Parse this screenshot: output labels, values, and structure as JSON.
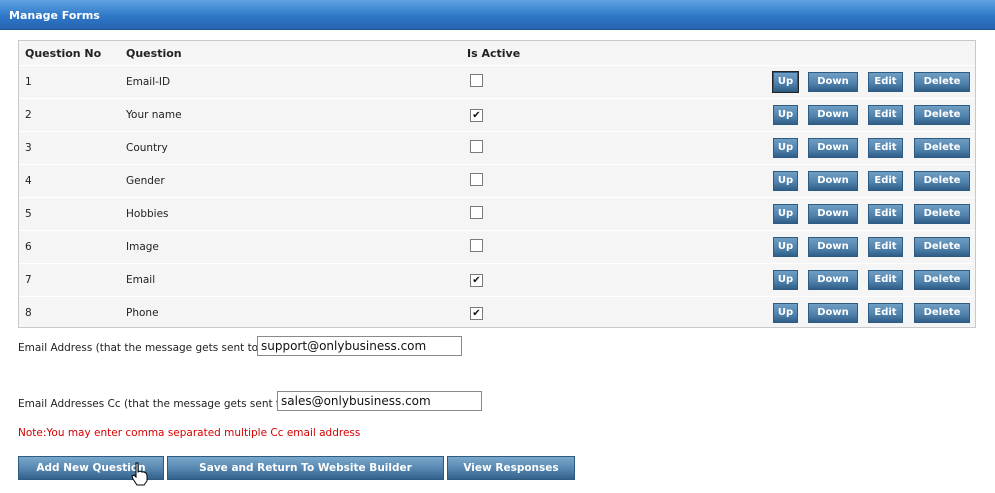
{
  "header": {
    "title": "Manage Forms"
  },
  "table": {
    "columns": [
      "Question No",
      "Question",
      "Is Active"
    ],
    "rows": [
      {
        "no": "1",
        "question": "Email-ID",
        "active": false
      },
      {
        "no": "2",
        "question": "Your name",
        "active": true
      },
      {
        "no": "3",
        "question": "Country",
        "active": false
      },
      {
        "no": "4",
        "question": "Gender",
        "active": false
      },
      {
        "no": "5",
        "question": "Hobbies",
        "active": false
      },
      {
        "no": "6",
        "question": "Image",
        "active": false
      },
      {
        "no": "7",
        "question": "Email",
        "active": true
      },
      {
        "no": "8",
        "question": "Phone",
        "active": true
      }
    ],
    "actions": {
      "up": "Up",
      "down": "Down",
      "edit": "Edit",
      "delete": "Delete"
    }
  },
  "email": {
    "label": "Email Address (that the message gets sent to)* :",
    "value": "support@onlybusiness.com"
  },
  "cc": {
    "label": "Email Addresses Cc (that the message gets sent to) :",
    "value": "sales@onlybusiness.com"
  },
  "note": "Note:You may enter comma separated multiple Cc email address",
  "buttons": {
    "add": "Add New Question",
    "save": "Save and Return To Website Builder",
    "responses": "View Responses"
  },
  "colors": {
    "header": "#2f78c8",
    "button": "#4e80ab",
    "note": "#d40000"
  }
}
